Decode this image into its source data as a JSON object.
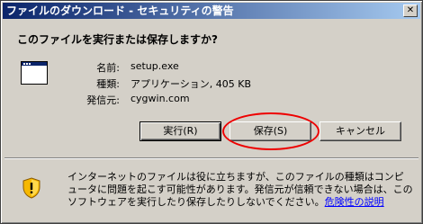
{
  "window": {
    "title": "ファイルのダウンロード - セキュリティの警告",
    "close_glyph": "✕"
  },
  "dialog": {
    "question": "このファイルを実行または保存しますか?",
    "file_icon": "program-window-icon",
    "fields": [
      {
        "label": "名前:",
        "value": "setup.exe"
      },
      {
        "label": "種類:",
        "value": "アプリケーション, 405 KB"
      },
      {
        "label": "発信元:",
        "value": "cygwin.com"
      }
    ],
    "buttons": {
      "run": "実行(R)",
      "save": "保存(S)",
      "cancel": "キャンセル"
    },
    "annotation_color": "#ee0000"
  },
  "warning": {
    "icon": "shield-warning-icon",
    "text": "インターネットのファイルは役に立ちますが、このファイルの種類はコンピュータに問題を起こす可能性があります。発信元が信頼できない場合は、このソフトウェアを実行したり保存したりしないでください。",
    "link": "危険性の説明"
  }
}
